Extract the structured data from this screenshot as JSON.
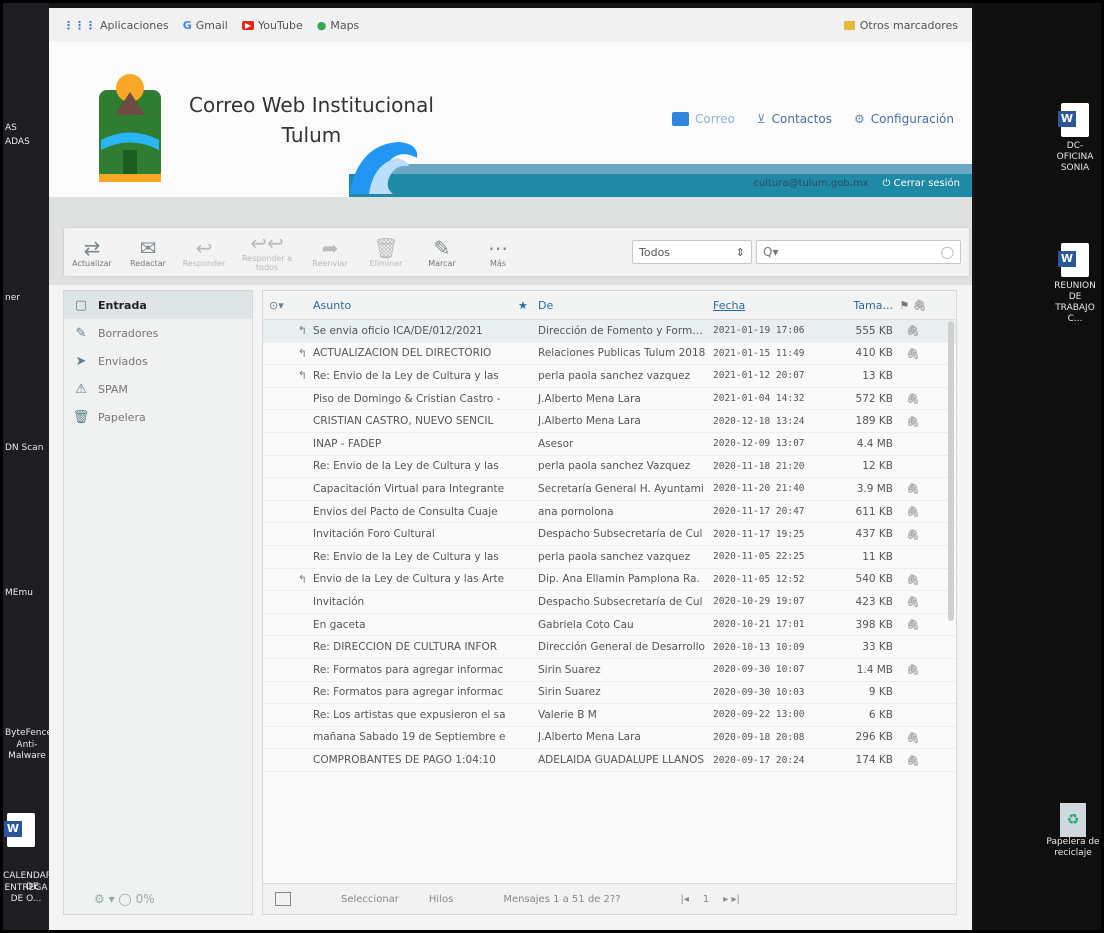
{
  "desktop": {
    "left_labels": [
      "AS",
      "ADAS",
      "ner",
      "DN Scan",
      "MEmu",
      "ByteFence",
      "Anti-Malware",
      "CALENDARIO DE",
      "ENTREGA DE O..."
    ],
    "right_icons": [
      {
        "label_1": "DC-OFICINA",
        "label_2": "SONIA",
        "glyph": "W"
      },
      {
        "label_1": "REUNION DE",
        "label_2": "TRABAJO C...",
        "glyph": "W"
      },
      {
        "label_1": "Papelera de",
        "label_2": "reciclaje",
        "glyph": "♻"
      }
    ],
    "calendar_glyph": "W"
  },
  "bookmarks": {
    "items": [
      {
        "icon": "⋮⋮⋮",
        "label": "Aplicaciones"
      },
      {
        "icon": "G",
        "label": "Gmail"
      },
      {
        "icon": "▶",
        "label": "YouTube"
      },
      {
        "icon": "●",
        "label": "Maps"
      }
    ],
    "other": "Otros marcadores"
  },
  "header": {
    "title_line1": "Correo Web Institucional",
    "title_line2": "Tulum",
    "nav": {
      "mail": "Correo",
      "contacts": "Contactos",
      "settings": "Configuración"
    },
    "user_email": "cultura@tulum.gob.mx",
    "logout": "Cerrar sesión"
  },
  "toolbar": {
    "buttons": [
      {
        "glyph": "⇄",
        "label": "Actualizar",
        "dim": false
      },
      {
        "glyph": "✉",
        "label": "Redactar",
        "dim": false
      },
      {
        "glyph": "↩",
        "label": "Responder",
        "dim": true
      },
      {
        "glyph": "↩↩",
        "label": "Responder a todos",
        "dim": true
      },
      {
        "glyph": "➦",
        "label": "Reenviar",
        "dim": true
      },
      {
        "glyph": "🗑",
        "label": "Eliminar",
        "dim": true
      },
      {
        "glyph": "✎",
        "label": "Marcar",
        "dim": false
      },
      {
        "glyph": "⋯",
        "label": "Más",
        "dim": false
      }
    ],
    "filter_value": "Todos",
    "search_placeholder": "Q▾"
  },
  "folders": {
    "items": [
      {
        "icon": "▢",
        "label": "Entrada",
        "selected": true
      },
      {
        "icon": "✎",
        "label": "Borradores",
        "selected": false
      },
      {
        "icon": "➤",
        "label": "Enviados",
        "selected": false
      },
      {
        "icon": "⚠",
        "label": "SPAM",
        "selected": false
      },
      {
        "icon": "🗑",
        "label": "Papelera",
        "selected": false
      }
    ],
    "status": "⚙ ▾  ◯ 0%"
  },
  "messages": {
    "columns": {
      "subject": "Asunto",
      "from": "De",
      "date": "Fecha",
      "size": "Tama..."
    },
    "rows": [
      {
        "icon": "↰",
        "subject": "Se envia oficio ICA/DE/012/2021",
        "from": "Dirección de Fomento y Formac...",
        "date": "2021-01-19 17:06",
        "size": "555 KB",
        "att": "🖇"
      },
      {
        "icon": "↰",
        "subject": "ACTUALIZACION DEL DIRECTORIO",
        "from": "Relaciones Publicas Tulum 2018",
        "date": "2021-01-15 11:49",
        "size": "410 KB",
        "att": "🖇"
      },
      {
        "icon": "↰",
        "subject": "Re: Envio de la Ley de Cultura y las",
        "from": "perla paola sanchez vazquez",
        "date": "2021-01-12 20:07",
        "size": "13 KB",
        "att": ""
      },
      {
        "icon": "",
        "subject": "Piso de Domingo & Cristian Castro -",
        "from": "J.Alberto Mena Lara",
        "date": "2021-01-04 14:32",
        "size": "572 KB",
        "att": "🖇"
      },
      {
        "icon": "",
        "subject": "CRISTIAN CASTRO, NUEVO SENCIL",
        "from": "J.Alberto Mena Lara",
        "date": "2020-12-18 13:24",
        "size": "189 KB",
        "att": "🖇"
      },
      {
        "icon": "",
        "subject": "INAP - FADEP",
        "from": "Asesor",
        "date": "2020-12-09 13:07",
        "size": "4.4 MB",
        "att": ""
      },
      {
        "icon": "",
        "subject": "Re: Envio de la Ley de Cultura y las",
        "from": "perla paola sanchez Vazquez",
        "date": "2020-11-18 21:20",
        "size": "12 KB",
        "att": ""
      },
      {
        "icon": "",
        "subject": "Capacitación Virtual para Integrante",
        "from": "Secretaría General H. Ayuntami",
        "date": "2020-11-20 21:40",
        "size": "3.9 MB",
        "att": "🖇"
      },
      {
        "icon": "",
        "subject": "Envios del Pacto de Consulta Cuaje",
        "from": "ana pornolona",
        "date": "2020-11-17 20:47",
        "size": "611 KB",
        "att": "🖇"
      },
      {
        "icon": "",
        "subject": "Invitación Foro Cultural",
        "from": "Despacho Subsecretaría de Cul",
        "date": "2020-11-17 19:25",
        "size": "437 KB",
        "att": "🖇"
      },
      {
        "icon": "",
        "subject": "Re: Envio de la Ley de Cultura y las",
        "from": "perla paola sanchez vazquez",
        "date": "2020-11-05 22:25",
        "size": "11 KB",
        "att": ""
      },
      {
        "icon": "↰",
        "subject": "Envio de la Ley de Cultura y las Arte",
        "from": "Dip. Ana Ellamin Pamplona Ra.",
        "date": "2020-11-05 12:52",
        "size": "540 KB",
        "att": "🖇"
      },
      {
        "icon": "",
        "subject": "Invitación",
        "from": "Despacho Subsecretaría de Cul",
        "date": "2020-10-29 19:07",
        "size": "423 KB",
        "att": "🖇"
      },
      {
        "icon": "",
        "subject": "En gaceta",
        "from": "Gabriela Coto Cau",
        "date": "2020-10-21 17:01",
        "size": "398 KB",
        "att": "🖇"
      },
      {
        "icon": "",
        "subject": "Re: DIRECCION DE CULTURA INFOR",
        "from": "Dirección General de Desarrollo",
        "date": "2020-10-13 10:09",
        "size": "33 KB",
        "att": ""
      },
      {
        "icon": "",
        "subject": "Re: Formatos para agregar informac",
        "from": "Sirin Suarez",
        "date": "2020-09-30 10:07",
        "size": "1.4 MB",
        "att": "🖇"
      },
      {
        "icon": "",
        "subject": "Re: Formatos para agregar informac",
        "from": "Sirin Suarez",
        "date": "2020-09-30 10:03",
        "size": "9 KB",
        "att": ""
      },
      {
        "icon": "",
        "subject": "Re: Los artistas que expusieron el sa",
        "from": "Valerie B M",
        "date": "2020-09-22 13:00",
        "size": "6 KB",
        "att": ""
      },
      {
        "icon": "",
        "subject": "mañana Sabado 19 de Septiembre e",
        "from": "J.Alberto Mena Lara",
        "date": "2020-09-18 20:08",
        "size": "296 KB",
        "att": "🖇"
      },
      {
        "icon": "",
        "subject": "COMPROBANTES DE PAGO 1:04:10",
        "from": "ADELAIDA GUADALUPE LLANOS",
        "date": "2020-09-17 20:24",
        "size": "174 KB",
        "att": "🖇"
      }
    ],
    "footer": {
      "select": "Seleccionar",
      "threads": "Hilos",
      "count": "Mensajes 1 a 51 de 2??",
      "page": "1"
    }
  }
}
